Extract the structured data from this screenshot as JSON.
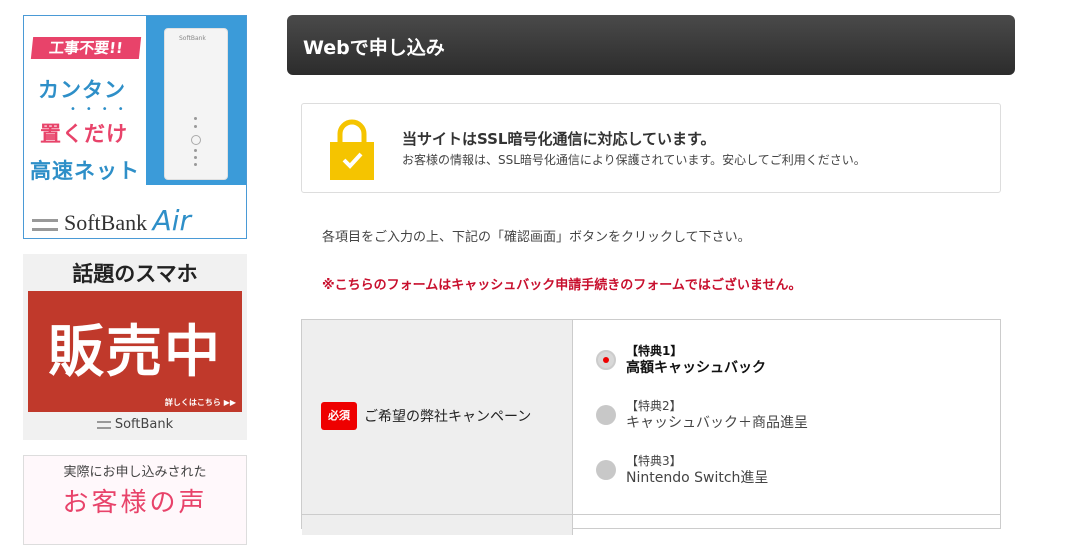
{
  "sidebar": {
    "banner_air": {
      "tag": "工事不要!!",
      "line1": "カンタン",
      "dots": "••••",
      "line2": "置くだけ",
      "line3": "高速ネット",
      "brand": "SoftBank",
      "brand_air": "Air",
      "device_brand": "SoftBank"
    },
    "banner_phone": {
      "head": "話題のスマホ",
      "big": "販売中",
      "more": "詳しくはこちら ▶▶",
      "brand": "SoftBank"
    },
    "banner_voice": {
      "line1": "実際にお申し込みされた",
      "line2": "お客様の声"
    }
  },
  "main": {
    "title": "Webで申し込み",
    "ssl": {
      "title": "当サイトはSSL暗号化通信に対応しています。",
      "desc": "お客様の情報は、SSL暗号化通信により保護されています。安心してご利用ください。"
    },
    "instruction": "各項目をご入力の上、下記の「確認画面」ボタンをクリックして下さい。",
    "warning": "※こちらのフォームはキャッシュバック申請手続きのフォームではございません。",
    "form": {
      "required_badge": "必須",
      "campaign_label": "ご希望の弊社キャンペーン",
      "options": [
        {
          "tag": "【特典1】",
          "name": "高額キャッシュバック",
          "selected": true
        },
        {
          "tag": "【特典2】",
          "name": "キャッシュバック＋商品進呈",
          "selected": false
        },
        {
          "tag": "【特典3】",
          "name": "Nintendo Switch進呈",
          "selected": false
        }
      ]
    }
  },
  "colors": {
    "header_bg": "#3a3a3a",
    "warning": "#c8102e",
    "required": "#ee0000",
    "lock": "#f5c400",
    "air_blue": "#2e8fc8",
    "air_pink": "#e8436a"
  }
}
